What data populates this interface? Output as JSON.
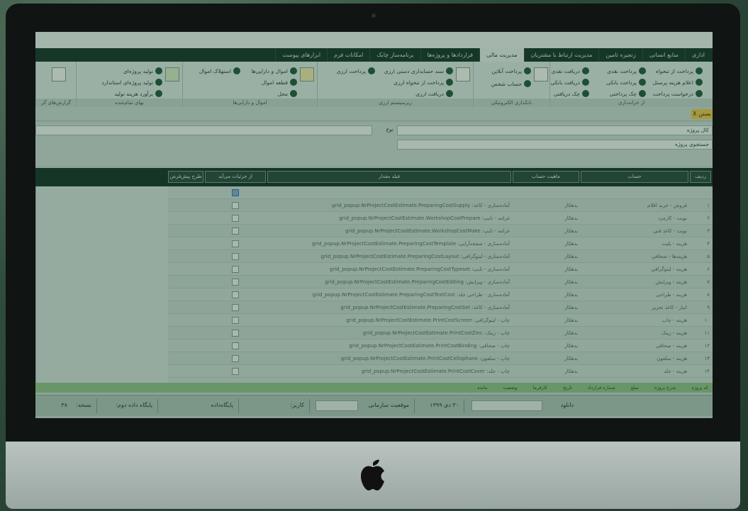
{
  "tabs": [
    {
      "label": "اداری",
      "active": false
    },
    {
      "label": "منابع انسانی",
      "active": false
    },
    {
      "label": "زنجیره تامین",
      "active": false
    },
    {
      "label": "مدیریت ارتباط با مشتریان",
      "active": false
    },
    {
      "label": "مدیریت مالی",
      "active": true
    },
    {
      "label": "قراردادها و پروژه‌ها",
      "active": false
    },
    {
      "label": "برنامه‌ساز چابک",
      "active": false
    },
    {
      "label": "امکانات فرم",
      "active": false
    },
    {
      "label": "ابزارهای پیوست",
      "active": false
    }
  ],
  "ribbon": {
    "groups": [
      "از خزانه‌داری",
      "بانکداری الکترونیکی",
      "زیرسیستم ارزی",
      "اموال و دارایی‌ها",
      "بهای تمام‌شده",
      "گزارش‌های گر"
    ],
    "g1": [
      "دریافت نقدی",
      "پرداخت نقدی",
      "پرداخت از تنخواه",
      "دریافت بانکی",
      "پرداخت بانکی",
      "اعلام هزینه پرسنل",
      "چک دریافتی",
      "چک پرداختی",
      "درخواست پرداخت"
    ],
    "g2": [
      "پرداخت آنلاین",
      "حساب شخص"
    ],
    "g3": [
      "سند حسابداری دستی ارزی",
      "پرداخت ارزی",
      "پرداخت از تنخواه ارزی",
      "دریافت ارزی"
    ],
    "g4": [
      "اموال و دارایی‌ها",
      "استهلاک اموال",
      "قطعه اموال",
      "محل"
    ],
    "g5": [
      "تولید پروژه‌ای",
      "تولید پروژه‌ای استاندارد",
      "برآورد هزینه تولید"
    ]
  },
  "close_label": "بستن X",
  "filters": {
    "project_select": "کال پروژه",
    "project_select2": "جستجوی پروژه",
    "type_label": "نوع"
  },
  "table": {
    "headers": [
      "ردیف",
      "حساب",
      "ماهیت حساب",
      "فیلد مقدار",
      "از جزئیات می‌آید",
      "طرح پیش‌فرض"
    ],
    "rows": [
      {
        "num": "",
        "account": "",
        "nature": "",
        "field": "",
        "checked": true
      },
      {
        "num": "۱",
        "account": "فروش - خرید اقلام",
        "nature": "بدهکار",
        "field": "آماده‌سازی - کاغذ: grid_popup.NrProjectCostEstimate.PreparingCostSupply",
        "checked": false
      },
      {
        "num": "۲",
        "account": "نوبت - کارمزد",
        "nature": "بدهکار",
        "field": "غرامه - تایپ: grid_popup.NrProjectCostEstimate.WorkshopCostPrepare",
        "checked": false
      },
      {
        "num": "۳",
        "account": "نوبت - کاغذ فنی",
        "nature": "بدهکار",
        "field": "غرامه - تایپ: grid_popup.NrProjectCostEstimate.WorkshopCostMake",
        "checked": false
      },
      {
        "num": "۴",
        "account": "هزینه - پلیت",
        "nature": "بدهکار",
        "field": "آماده‌سازی - صفحه‌آرایی: grid_popup.NrProjectCostEstimate.PreparingCostTemplate",
        "checked": false
      },
      {
        "num": "۵",
        "account": "هزینه‌ها - صحافی",
        "nature": "بدهکار",
        "field": "آماده‌سازی - لیتوگرافی: grid_popup.NrProjectCostEstimate.PreparingCostLayout",
        "checked": false
      },
      {
        "num": "۶",
        "account": "هزینه - لیتوگرافی",
        "nature": "بدهکار",
        "field": "آماده‌سازی - تایپ: grid_popup.NrProjectCostEstimate.PreparingCostTypeset",
        "checked": false
      },
      {
        "num": "۷",
        "account": "هزینه - ویرایش",
        "nature": "بدهکار",
        "field": "آماده‌سازی - ویرایش: grid_popup.NrProjectCostEstimate.PreparingCostEditing",
        "checked": false
      },
      {
        "num": "۸",
        "account": "هزینه - طراحی",
        "nature": "بدهکار",
        "field": "آماده‌سازی - طراحی جلد: grid_popup.NrProjectCostEstimate.PreparingCostTextCost",
        "checked": false
      },
      {
        "num": "۹",
        "account": "انبار - کاغذ تحریر",
        "nature": "بدهکار",
        "field": "آماده‌سازی - کاغذ: grid_popup.NrProjectCostEstimate.PreparingCostSet",
        "checked": false
      },
      {
        "num": "۱۰",
        "account": "هزینه - چاپ",
        "nature": "بدهکار",
        "field": "چاپ - لیتوگرافی: grid_popup.NrProjectCostEstimate.PrintCostScreen",
        "checked": false
      },
      {
        "num": "۱۱",
        "account": "هزینه - زینک",
        "nature": "بدهکار",
        "field": "چاپ - زینک: grid_popup.NrProjectCostEstimate.PrintCostZinc",
        "checked": false
      },
      {
        "num": "۱۲",
        "account": "هزینه - صحافی",
        "nature": "بدهکار",
        "field": "چاپ - صحافی: grid_popup.NrProjectCostEstimate.PrintCostBinding",
        "checked": false
      },
      {
        "num": "۱۳",
        "account": "هزینه - سلفون",
        "nature": "بدهکار",
        "field": "چاپ - سلفون: grid_popup.NrProjectCostEstimate.PrintCostCellophane",
        "checked": false
      },
      {
        "num": "۱۴",
        "account": "هزینه - جلد",
        "nature": "بدهکار",
        "field": "چاپ - جلد: grid_popup.NrProjectCostEstimate.PrintCostCover",
        "checked": false
      }
    ]
  },
  "greenbar": [
    "کد پروژه",
    "شرح پروژه",
    "مبلغ",
    "شماره قرارداد",
    "تاریخ",
    "کارفرما",
    "وضعیت",
    "مانده"
  ],
  "status": {
    "download_label": "دانلود",
    "date": "۳۰ دی ۱۳۹۹",
    "org_label": "موقعیت سازمانی",
    "user_label": "کاربر:",
    "db_label": "پایگاه‌داده",
    "db2_label": "پایگاه داده دوم:",
    "version_label": "نسخه:",
    "version_value": "۳۸"
  }
}
